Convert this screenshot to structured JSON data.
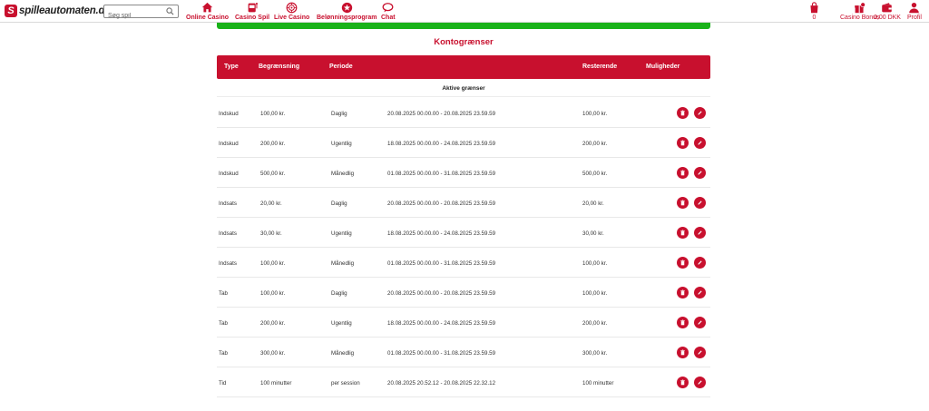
{
  "header": {
    "logo_mark": "S",
    "logo_text": "spilleautomaten.dk",
    "search_placeholder": "Søg spil",
    "nav": [
      {
        "label": "Online Casino",
        "icon": "home-icon"
      },
      {
        "label": "Casino Spil",
        "icon": "slot-machine-icon"
      },
      {
        "label": "Live Casino",
        "icon": "roulette-icon"
      },
      {
        "label": "Belønningsprogram",
        "icon": "star-badge-icon"
      },
      {
        "label": "Chat",
        "icon": "chat-icon"
      }
    ],
    "right": [
      {
        "label": "0",
        "icon": "bag-icon"
      },
      {
        "label": "Casino Bonus",
        "icon": "gift-icon"
      },
      {
        "label": "0,00 DKK",
        "icon": "wallet-icon"
      },
      {
        "label": "Profil",
        "icon": "user-icon"
      }
    ]
  },
  "page": {
    "title": "Kontogrænser",
    "columns": {
      "type": "Type",
      "limit": "Begrænsning",
      "period": "Periode",
      "remaining": "Resterende",
      "options": "Muligheder"
    },
    "section_label": "Aktive grænser",
    "rows": [
      {
        "type": "Indskud",
        "limit": "100,00 kr.",
        "period": "Daglig",
        "range": "20.08.2025 00.00.00 - 20.08.2025 23.59.59",
        "remaining": "100,00 kr."
      },
      {
        "type": "Indskud",
        "limit": "200,00 kr.",
        "period": "Ugentlig",
        "range": "18.08.2025 00.00.00 - 24.08.2025 23.59.59",
        "remaining": "200,00 kr."
      },
      {
        "type": "Indskud",
        "limit": "500,00 kr.",
        "period": "Månedlig",
        "range": "01.08.2025 00.00.00 - 31.08.2025 23.59.59",
        "remaining": "500,00 kr."
      },
      {
        "type": "Indsats",
        "limit": "20,00 kr.",
        "period": "Daglig",
        "range": "20.08.2025 00.00.00 - 20.08.2025 23.59.59",
        "remaining": "20,00 kr."
      },
      {
        "type": "Indsats",
        "limit": "30,00 kr.",
        "period": "Ugentlig",
        "range": "18.08.2025 00.00.00 - 24.08.2025 23.59.59",
        "remaining": "30,00 kr."
      },
      {
        "type": "Indsats",
        "limit": "100,00 kr.",
        "period": "Månedlig",
        "range": "01.08.2025 00.00.00 - 31.08.2025 23.59.59",
        "remaining": "100,00 kr."
      },
      {
        "type": "Tab",
        "limit": "100,00 kr.",
        "period": "Daglig",
        "range": "20.08.2025 00.00.00 - 20.08.2025 23.59.59",
        "remaining": "100,00 kr."
      },
      {
        "type": "Tab",
        "limit": "200,00 kr.",
        "period": "Ugentlig",
        "range": "18.08.2025 00.00.00 - 24.08.2025 23.59.59",
        "remaining": "200,00 kr."
      },
      {
        "type": "Tab",
        "limit": "300,00 kr.",
        "period": "Månedlig",
        "range": "01.08.2025 00.00.00 - 31.08.2025 23.59.59",
        "remaining": "300,00 kr."
      },
      {
        "type": "Tid",
        "limit": "100 minutter",
        "period": "per session",
        "range": "20.08.2025 20.52.12 - 20.08.2025 22.32.12",
        "remaining": "100 minutter"
      }
    ]
  },
  "colors": {
    "brand": "#c8102e",
    "progress": "#19b219"
  }
}
